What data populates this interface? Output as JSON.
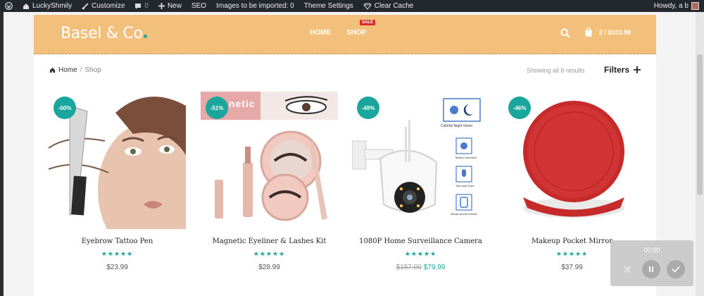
{
  "adminbar": {
    "site_name": "LuckyShmily",
    "customize": "Customize",
    "comments_count": "0",
    "new_label": "New",
    "seo": "SEO",
    "images_import": "Images to be imported: 0",
    "theme_settings": "Theme Settings",
    "clear_cache": "Clear Cache",
    "howdy": "Howdy, a b"
  },
  "header": {
    "logo": "Basel & Co",
    "nav": {
      "home": "HOME",
      "shop": "SHOP",
      "sale_badge": "SALE"
    },
    "cart": {
      "summary": "2 / $103.98"
    }
  },
  "breadcrumb": {
    "home": "Home",
    "separator": "/",
    "current": "Shop"
  },
  "results_text": "Showing all 6 results",
  "filters_label": "Filters",
  "products": [
    {
      "name": "Eyebrow Tattoo Pen",
      "discount": "-60%",
      "rating_stars": "★★★★★",
      "price": "$23.99"
    },
    {
      "name": "Magnetic Eyeliner & Lashes Kit",
      "discount": "-51%",
      "rating_stars": "★★★★★",
      "price": "$28.99",
      "banner_text": "netic"
    },
    {
      "name": "1080P Home Surveillance Camera",
      "discount": "-49%",
      "rating_stars": "★★★★★",
      "old_price": "$157.00",
      "price": "$79.99",
      "features": [
        "Colorful Night Vision",
        "Motion Detection",
        "Two-way Voice",
        "Mobile phone remote"
      ]
    },
    {
      "name": "Makeup Pocket Mirror",
      "discount": "-46%",
      "rating_stars": "★★★★★",
      "price": "$37.99"
    }
  ],
  "recorder": {
    "time": "00:00"
  },
  "colors": {
    "header_bg": "#f2c07b",
    "accent": "#1aa69c",
    "sale": "#d92b2b",
    "adminbar": "#23282d"
  }
}
